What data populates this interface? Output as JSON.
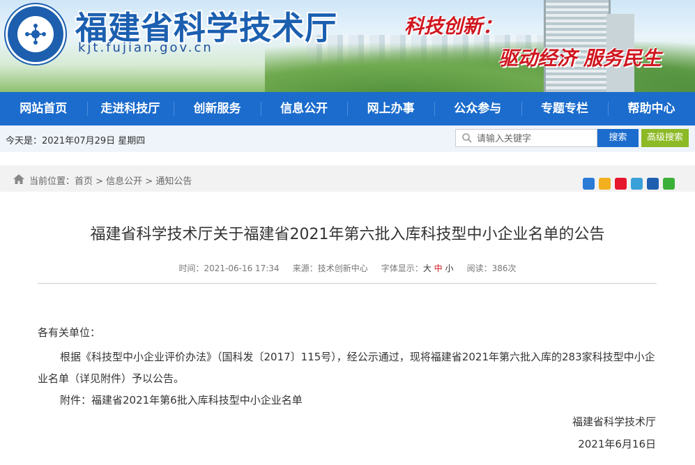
{
  "header": {
    "site_name": "福建省科学技术厅",
    "domain": "kjt.fujian.gov.cn",
    "slogan_line1": "科技创新：",
    "slogan_line2": "驱动经济 服务民生"
  },
  "nav": {
    "items": [
      "网站首页",
      "走进科技厅",
      "创新服务",
      "信息公开",
      "网上办事",
      "公众参与",
      "专题专栏",
      "帮助中心"
    ]
  },
  "infobar": {
    "date_text": "今天是：2021年07月29日  星期四",
    "search_placeholder": "请输入关键字",
    "search_button": "搜索",
    "advanced_button": "高级搜索"
  },
  "breadcrumb": {
    "text": "当前位置：首页 > 信息公开 > 通知公告"
  },
  "share_icons": [
    "plus-share-icon",
    "qzone-icon",
    "weibo-icon",
    "tencent-weibo-icon",
    "renren-icon",
    "wechat-icon"
  ],
  "article": {
    "title": "福建省科学技术厅关于福建省2021年第六批入库科技型中小企业名单的公告",
    "meta_time": "时间：2021-06-16 17:34",
    "meta_source": "来源：技术创新中心",
    "meta_font_label": "字体显示：",
    "font_large": "大",
    "font_medium": "中",
    "font_small": "小",
    "meta_views": "阅读：386次",
    "greeting": "各有关单位：",
    "body": "根据《科技型中小企业评价办法》（国科发〔2017〕115号），经公示通过，现将福建省2021年第六批入库的283家科技型中小企业名单（详见附件）予以公告。",
    "attachment": "附件：福建省2021年第6批入库科技型中小企业名单",
    "signature": "福建省科学技术厅",
    "sign_date": "2021年6月16日"
  },
  "colors": {
    "nav_blue": "#1b6ccd",
    "advanced_green": "#8cb925",
    "slogan_red": "#d0161f"
  }
}
